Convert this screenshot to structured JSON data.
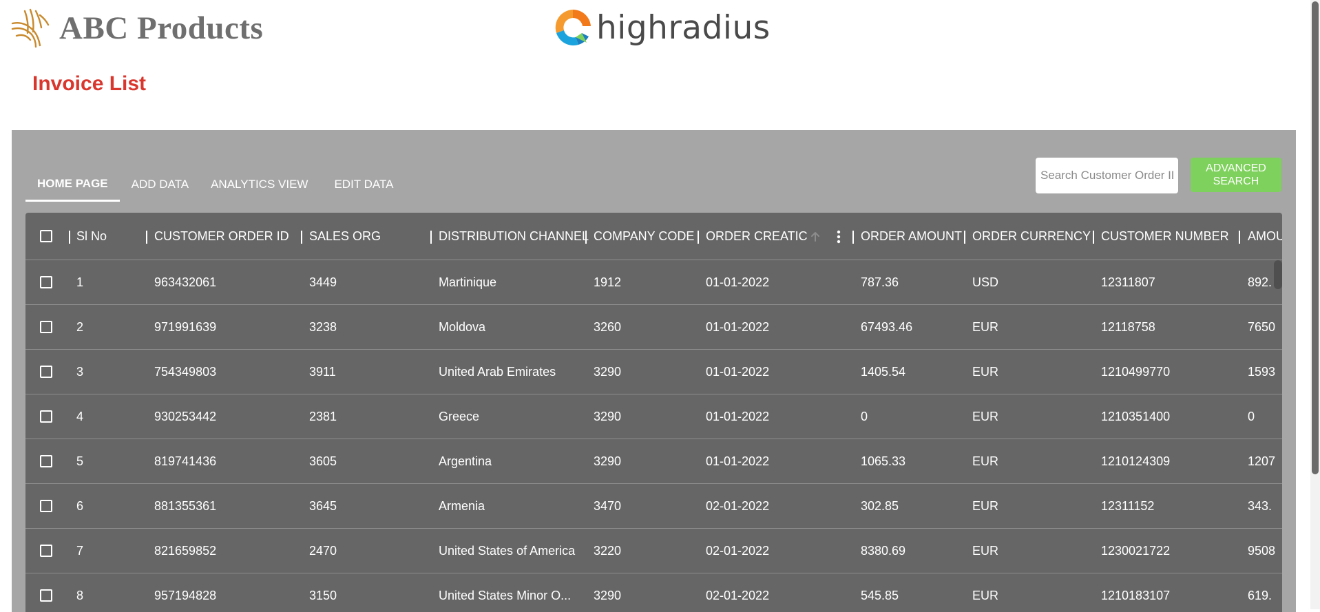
{
  "header": {
    "brand_name": "ABC Products",
    "partner_name": "highradius",
    "page_title": "Invoice List"
  },
  "tabs": [
    {
      "label": "HOME PAGE",
      "active": true
    },
    {
      "label": "ADD DATA",
      "active": false
    },
    {
      "label": "ANALYTICS VIEW",
      "active": false
    },
    {
      "label": "EDIT DATA",
      "active": false
    }
  ],
  "search": {
    "placeholder": "Search Customer Order ID",
    "value": ""
  },
  "advanced_search": {
    "line1": "ADVANCED",
    "line2": "SEARCH"
  },
  "table": {
    "columns": [
      "Sl No",
      "CUSTOMER ORDER ID",
      "SALES ORG",
      "DISTRIBUTION CHANNEL",
      "COMPANY CODE",
      "ORDER CREATIC",
      "ORDER AMOUNT",
      "ORDER CURRENCY",
      "CUSTOMER NUMBER",
      "AMOU"
    ],
    "sorted_column": "ORDER CREATIC",
    "rows": [
      [
        "1",
        "963432061",
        "3449",
        "Martinique",
        "1912",
        "01-01-2022",
        "787.36",
        "USD",
        "12311807",
        "892."
      ],
      [
        "2",
        "971991639",
        "3238",
        "Moldova",
        "3260",
        "01-01-2022",
        "67493.46",
        "EUR",
        "12118758",
        "7650"
      ],
      [
        "3",
        "754349803",
        "3911",
        "United Arab Emirates",
        "3290",
        "01-01-2022",
        "1405.54",
        "EUR",
        "1210499770",
        "1593"
      ],
      [
        "4",
        "930253442",
        "2381",
        "Greece",
        "3290",
        "01-01-2022",
        "0",
        "EUR",
        "1210351400",
        "0"
      ],
      [
        "5",
        "819741436",
        "3605",
        "Argentina",
        "3290",
        "01-01-2022",
        "1065.33",
        "EUR",
        "1210124309",
        "1207"
      ],
      [
        "6",
        "881355361",
        "3645",
        "Armenia",
        "3470",
        "02-01-2022",
        "302.85",
        "EUR",
        "12311152",
        "343."
      ],
      [
        "7",
        "821659852",
        "2470",
        "United States of America",
        "3220",
        "02-01-2022",
        "8380.69",
        "EUR",
        "1230021722",
        "9508"
      ],
      [
        "8",
        "957194828",
        "3150",
        "United States Minor O...",
        "3290",
        "02-01-2022",
        "545.85",
        "EUR",
        "1210183107",
        "619."
      ]
    ]
  },
  "colors": {
    "title_red": "#d9362d",
    "panel_gray": "#a6a6a6",
    "grid_gray": "#666666",
    "button_green": "#7ed15c"
  },
  "icons": [
    "brand-logo-icon",
    "highradius-logo-icon",
    "sort-arrow-up-icon",
    "column-menu-icon"
  ]
}
